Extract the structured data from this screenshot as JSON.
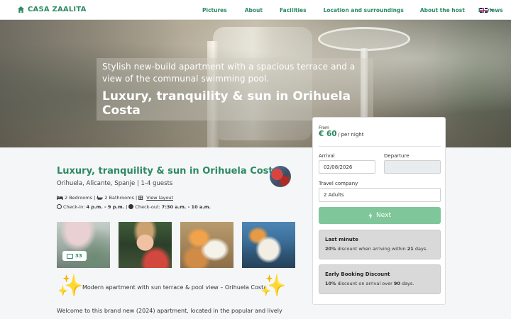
{
  "nav": {
    "brand": "CASA ZAALITA",
    "items": [
      "Pictures",
      "About",
      "Facilities",
      "Location and surroundings",
      "About the host",
      "Reviews"
    ],
    "language_icon": "uk-flag-icon"
  },
  "hero": {
    "subtitle": "Stylish new-build apartment with a spacious terrace and a view of the communal swimming pool.",
    "title": "Luxury, tranquility & sun in Orihuela Costa"
  },
  "property": {
    "title": "Luxury, tranquility & sun in Orihuela Costa",
    "location": "Orihuela, Alicante, Spanje | 1-4 guests",
    "bedrooms": "2 Bedrooms",
    "bathrooms": "2 Bathrooms",
    "layout_link": "View layout",
    "checkin_label": "Check-in:",
    "checkin_time": "4 p.m. - 9 p.m.",
    "checkout_label": "Check-out:",
    "checkout_time": "7:30 a.m. - 10 a.m.",
    "photo_count": "33",
    "tagline": "Modern apartment with sun terrace & pool view – Orihuela Costa",
    "welcome": "Welcome to this brand new (2024) apartment, located in the popular and lively"
  },
  "booking": {
    "from_label": "From",
    "price": "€ 60",
    "per_night": "/ per night",
    "arrival_label": "Arrival",
    "arrival_value": "02/08/2026",
    "departure_label": "Departure",
    "departure_value": "",
    "company_label": "Travel company",
    "company_value": "2 Adults",
    "next_label": "Next",
    "last_minute": {
      "title": "Last minute",
      "pct": "20%",
      "mid": "discount when arriving within",
      "days": "21",
      "end": "days."
    },
    "early_booking": {
      "title": "Early Booking Discount",
      "pct": "10%",
      "mid": "discount on arrival over",
      "days": "90",
      "end": "days."
    }
  },
  "colors": {
    "brand_green": "#2d8a63",
    "button_green": "#7fc79a"
  }
}
